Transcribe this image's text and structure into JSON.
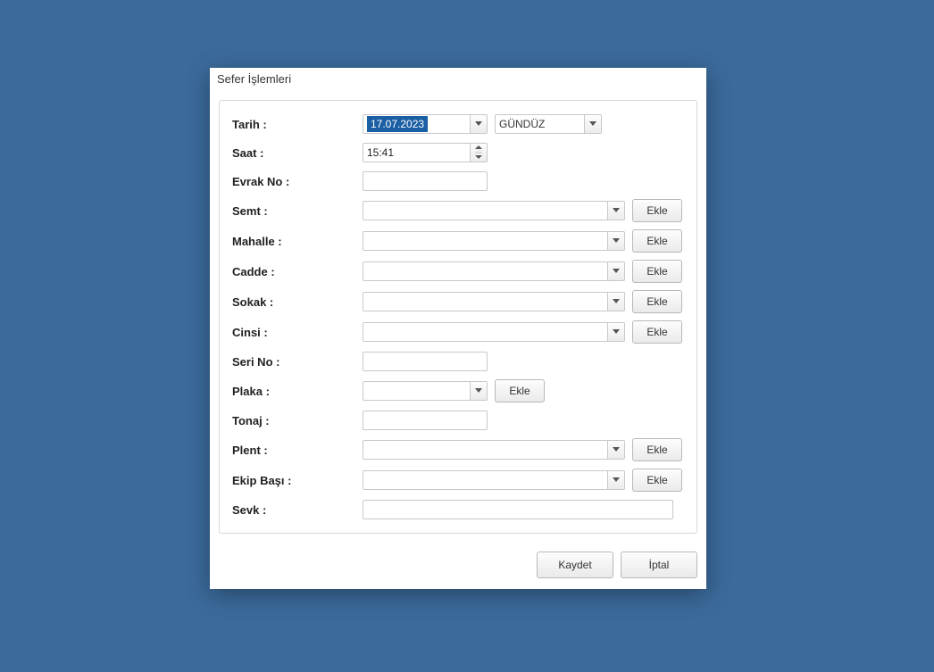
{
  "dialog": {
    "title": "Sefer İşlemleri"
  },
  "labels": {
    "tarih": "Tarih :",
    "saat": "Saat :",
    "evrakno": "Evrak No :",
    "semt": "Semt :",
    "mahalle": "Mahalle :",
    "cadde": "Cadde :",
    "sokak": "Sokak :",
    "cinsi": "Cinsi :",
    "serino": "Seri No  :",
    "plaka": "Plaka :",
    "tonaj": "Tonaj :",
    "plent": "Plent :",
    "ekipbasi": "Ekip Başı :",
    "sevk": "Sevk :"
  },
  "values": {
    "tarih": "17.07.2023",
    "vardiya": "GÜNDÜZ",
    "saat": "15:41",
    "evrakno": "",
    "semt": "",
    "mahalle": "",
    "cadde": "",
    "sokak": "",
    "cinsi": "",
    "serino": "",
    "plaka": "",
    "tonaj": "",
    "plent": "",
    "ekipbasi": "",
    "sevk": ""
  },
  "buttons": {
    "ekle": "Ekle",
    "kaydet": "Kaydet",
    "iptal": "İptal"
  }
}
